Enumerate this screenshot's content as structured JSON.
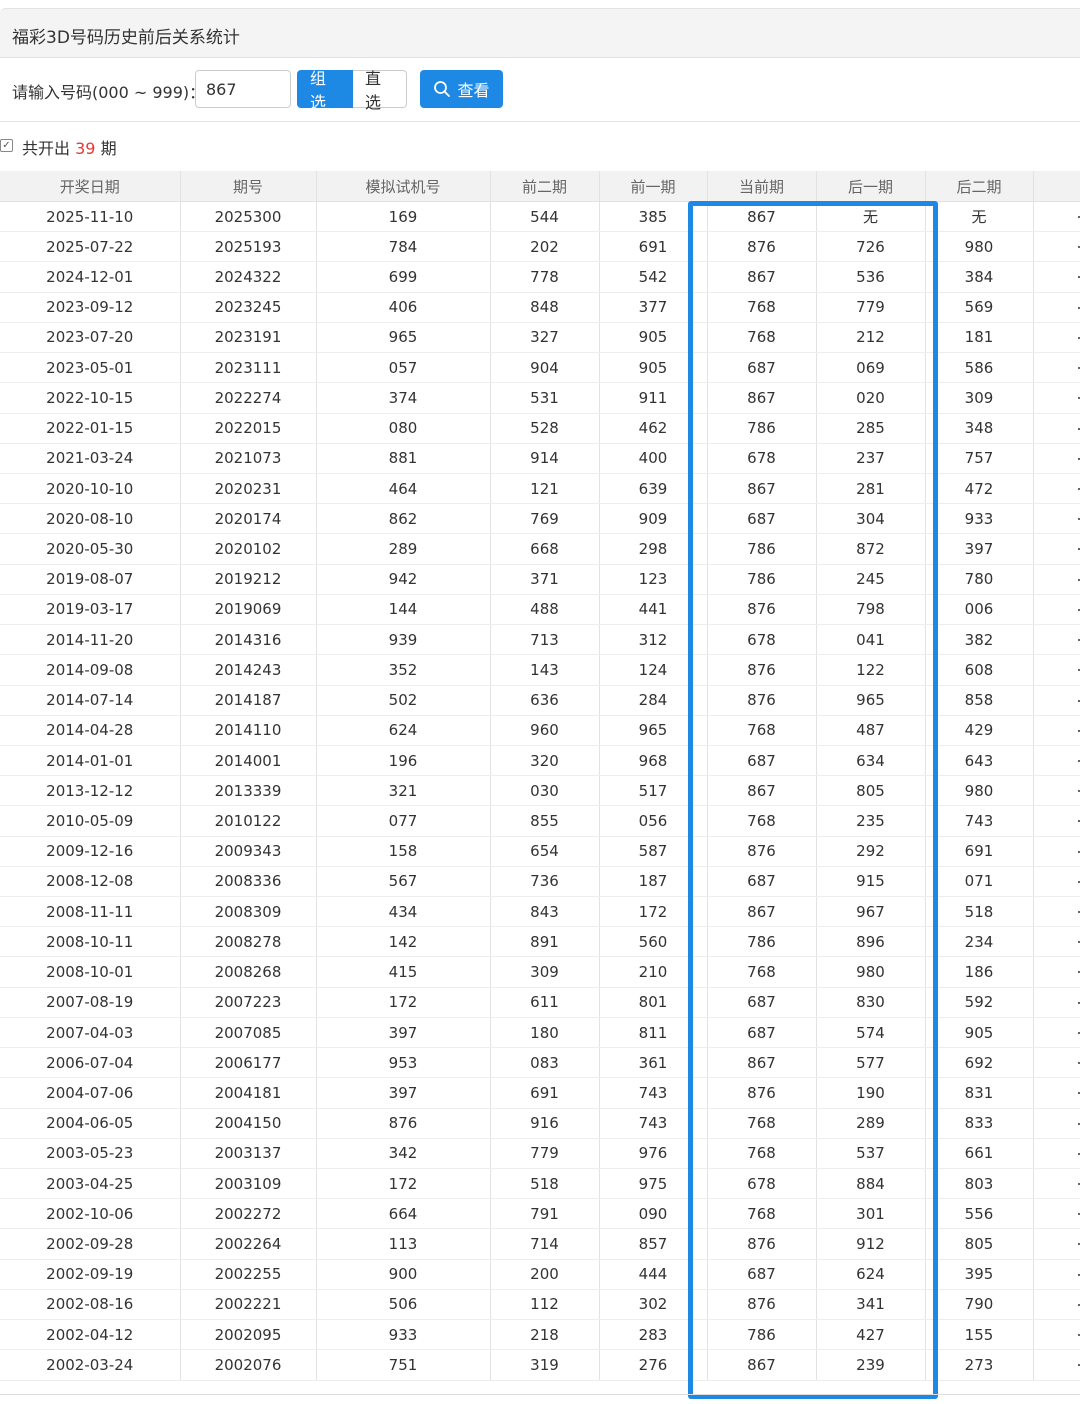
{
  "page_title": "福彩3D号码历史前后关系统计",
  "form": {
    "label": "请输入号码(000 ~ 999)：",
    "input_value": "867",
    "btn_group": "组选",
    "btn_direct": "直选",
    "btn_view": "查看"
  },
  "summary": {
    "prefix": "共开出",
    "count": "39",
    "suffix": "期"
  },
  "colors": {
    "accent": "#1e88e5",
    "count_red": "#e53935"
  },
  "icons": {
    "view": "search-icon",
    "summary": "checkbox-icon"
  },
  "table": {
    "headers": [
      "开奖日期",
      "期号",
      "模拟试机号",
      "前二期",
      "前一期",
      "当前期",
      "后一期",
      "后二期"
    ],
    "rows": [
      [
        "2025-11-10",
        "2025300",
        "169",
        "544",
        "385",
        "867",
        "无",
        "无"
      ],
      [
        "2025-07-22",
        "2025193",
        "784",
        "202",
        "691",
        "876",
        "726",
        "980"
      ],
      [
        "2024-12-01",
        "2024322",
        "699",
        "778",
        "542",
        "867",
        "536",
        "384"
      ],
      [
        "2023-09-12",
        "2023245",
        "406",
        "848",
        "377",
        "768",
        "779",
        "569"
      ],
      [
        "2023-07-20",
        "2023191",
        "965",
        "327",
        "905",
        "768",
        "212",
        "181"
      ],
      [
        "2023-05-01",
        "2023111",
        "057",
        "904",
        "905",
        "687",
        "069",
        "586"
      ],
      [
        "2022-10-15",
        "2022274",
        "374",
        "531",
        "911",
        "867",
        "020",
        "309"
      ],
      [
        "2022-01-15",
        "2022015",
        "080",
        "528",
        "462",
        "786",
        "285",
        "348"
      ],
      [
        "2021-03-24",
        "2021073",
        "881",
        "914",
        "400",
        "678",
        "237",
        "757"
      ],
      [
        "2020-10-10",
        "2020231",
        "464",
        "121",
        "639",
        "867",
        "281",
        "472"
      ],
      [
        "2020-08-10",
        "2020174",
        "862",
        "769",
        "909",
        "687",
        "304",
        "933"
      ],
      [
        "2020-05-30",
        "2020102",
        "289",
        "668",
        "298",
        "786",
        "872",
        "397"
      ],
      [
        "2019-08-07",
        "2019212",
        "942",
        "371",
        "123",
        "786",
        "245",
        "780"
      ],
      [
        "2019-03-17",
        "2019069",
        "144",
        "488",
        "441",
        "876",
        "798",
        "006"
      ],
      [
        "2014-11-20",
        "2014316",
        "939",
        "713",
        "312",
        "678",
        "041",
        "382"
      ],
      [
        "2014-09-08",
        "2014243",
        "352",
        "143",
        "124",
        "876",
        "122",
        "608"
      ],
      [
        "2014-07-14",
        "2014187",
        "502",
        "636",
        "284",
        "876",
        "965",
        "858"
      ],
      [
        "2014-04-28",
        "2014110",
        "624",
        "960",
        "965",
        "768",
        "487",
        "429"
      ],
      [
        "2014-01-01",
        "2014001",
        "196",
        "320",
        "968",
        "687",
        "634",
        "643"
      ],
      [
        "2013-12-12",
        "2013339",
        "321",
        "030",
        "517",
        "867",
        "805",
        "980"
      ],
      [
        "2010-05-09",
        "2010122",
        "077",
        "855",
        "056",
        "768",
        "235",
        "743"
      ],
      [
        "2009-12-16",
        "2009343",
        "158",
        "654",
        "587",
        "876",
        "292",
        "691"
      ],
      [
        "2008-12-08",
        "2008336",
        "567",
        "736",
        "187",
        "687",
        "915",
        "071"
      ],
      [
        "2008-11-11",
        "2008309",
        "434",
        "843",
        "172",
        "867",
        "967",
        "518"
      ],
      [
        "2008-10-11",
        "2008278",
        "142",
        "891",
        "560",
        "786",
        "896",
        "234"
      ],
      [
        "2008-10-01",
        "2008268",
        "415",
        "309",
        "210",
        "768",
        "980",
        "186"
      ],
      [
        "2007-08-19",
        "2007223",
        "172",
        "611",
        "801",
        "687",
        "830",
        "592"
      ],
      [
        "2007-04-03",
        "2007085",
        "397",
        "180",
        "811",
        "687",
        "574",
        "905"
      ],
      [
        "2006-07-04",
        "2006177",
        "953",
        "083",
        "361",
        "867",
        "577",
        "692"
      ],
      [
        "2004-07-06",
        "2004181",
        "397",
        "691",
        "743",
        "876",
        "190",
        "831"
      ],
      [
        "2004-06-05",
        "2004150",
        "876",
        "916",
        "743",
        "768",
        "289",
        "833"
      ],
      [
        "2003-05-23",
        "2003137",
        "342",
        "779",
        "976",
        "768",
        "537",
        "661"
      ],
      [
        "2003-04-25",
        "2003109",
        "172",
        "518",
        "975",
        "678",
        "884",
        "803"
      ],
      [
        "2002-10-06",
        "2002272",
        "664",
        "791",
        "090",
        "768",
        "301",
        "556"
      ],
      [
        "2002-09-28",
        "2002264",
        "113",
        "714",
        "857",
        "876",
        "912",
        "805"
      ],
      [
        "2002-09-19",
        "2002255",
        "900",
        "200",
        "444",
        "687",
        "624",
        "395"
      ],
      [
        "2002-08-16",
        "2002221",
        "506",
        "112",
        "302",
        "876",
        "341",
        "790"
      ],
      [
        "2002-04-12",
        "2002095",
        "933",
        "218",
        "283",
        "786",
        "427",
        "155"
      ],
      [
        "2002-03-24",
        "2002076",
        "751",
        "319",
        "276",
        "867",
        "239",
        "273"
      ]
    ]
  }
}
